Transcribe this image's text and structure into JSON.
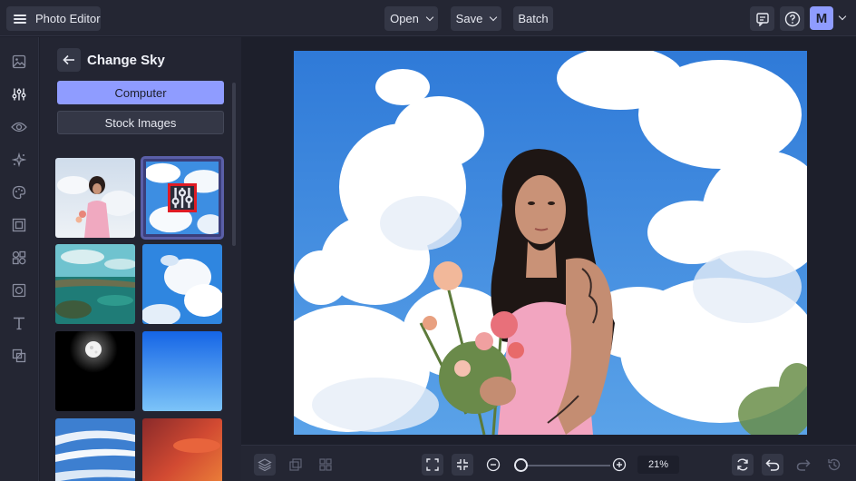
{
  "header": {
    "app_title": "Photo Editor",
    "menus": [
      {
        "label": "Open"
      },
      {
        "label": "Save"
      },
      {
        "label": "Batch"
      }
    ],
    "avatar_initial": "M"
  },
  "sidebar": {
    "icons": [
      "image-icon",
      "adjustments-icon",
      "eye-icon",
      "sparkle-icon",
      "palette-icon",
      "frame-icon",
      "shapes-icon",
      "texture-icon",
      "text-icon",
      "overlay-icon"
    ]
  },
  "panel": {
    "title": "Change Sky",
    "source_tabs": [
      {
        "label": "Computer",
        "active": true
      },
      {
        "label": "Stock Images",
        "active": false
      }
    ],
    "thumbnails": [
      {
        "name": "sky-thumb-original",
        "selected": false
      },
      {
        "name": "sky-thumb-clouds-selected",
        "selected": true
      },
      {
        "name": "sky-thumb-lagoon",
        "selected": false
      },
      {
        "name": "sky-thumb-clouds-2",
        "selected": false
      },
      {
        "name": "sky-thumb-moon",
        "selected": false
      },
      {
        "name": "sky-thumb-clear-blue",
        "selected": false
      },
      {
        "name": "sky-thumb-streaks",
        "selected": false
      },
      {
        "name": "sky-thumb-sunset",
        "selected": false
      }
    ]
  },
  "toolbar": {
    "zoom_level": "21%",
    "zoom_fraction": 0.08
  },
  "colors": {
    "accent": "#8f9cff",
    "background": "#1d1f2b",
    "panel": "#242633",
    "highlight_border": "#e01b24"
  }
}
